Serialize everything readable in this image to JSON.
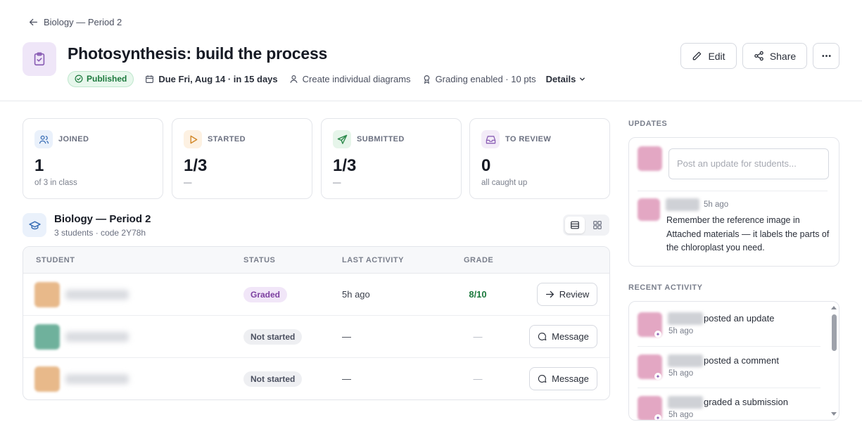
{
  "nav": {
    "back_label": "Biology — Period 2"
  },
  "assignment": {
    "title": "Photosynthesis: build the process",
    "status": "Published",
    "due": "Due Fri, Aug 14 · in 15 days",
    "mode": "Create individual diagrams",
    "grading": "Grading enabled · 10 pts",
    "details_label": "Details"
  },
  "actions": {
    "edit": "Edit",
    "share": "Share",
    "more": "More options"
  },
  "stats": [
    {
      "label": "JOINED",
      "value": "1",
      "sub": "of 3 in class",
      "icon": "users-icon",
      "color": "#eaf1fb",
      "accent": "#3b6fb6"
    },
    {
      "label": "STARTED",
      "value": "1/3",
      "sub": "—",
      "icon": "play-icon",
      "color": "#fdf1e2",
      "accent": "#d2882a"
    },
    {
      "label": "SUBMITTED",
      "value": "1/3",
      "sub": "—",
      "icon": "send-icon",
      "color": "#e6f5ea",
      "accent": "#2e8a4d"
    },
    {
      "label": "TO REVIEW",
      "value": "0",
      "sub": "all caught up",
      "icon": "inbox-icon",
      "color": "#f3ecf8",
      "accent": "#8b5fb5"
    }
  ],
  "class": {
    "name": "Biology — Period 2",
    "sub": "3 students · code 2Y78h"
  },
  "table": {
    "headers": {
      "student": "STUDENT",
      "status": "STATUS",
      "last": "LAST ACTIVITY",
      "grade": "GRADE"
    },
    "rows": [
      {
        "avatar_color": "#e8b98a",
        "status": "Graded",
        "status_kind": "graded",
        "last": "5h ago",
        "grade": "8/10",
        "action": "Review"
      },
      {
        "avatar_color": "#6fb19c",
        "status": "Not started",
        "status_kind": "notstarted",
        "last": "—",
        "grade": "—",
        "action": "Message"
      },
      {
        "avatar_color": "#e8b98a",
        "status": "Not started",
        "status_kind": "notstarted",
        "last": "—",
        "grade": "—",
        "action": "Message"
      }
    ]
  },
  "updates": {
    "label": "UPDATES",
    "placeholder": "Post an update for students...",
    "item": {
      "time": "5h ago",
      "text": "Remember the reference image in Attached materials — it labels the parts of the chloroplast you need."
    }
  },
  "recent": {
    "label": "RECENT ACTIVITY",
    "items": [
      {
        "text": "posted an update",
        "time": "5h ago"
      },
      {
        "text": "posted a comment",
        "time": "5h ago"
      },
      {
        "text": "graded a submission",
        "time": "5h ago"
      }
    ]
  }
}
